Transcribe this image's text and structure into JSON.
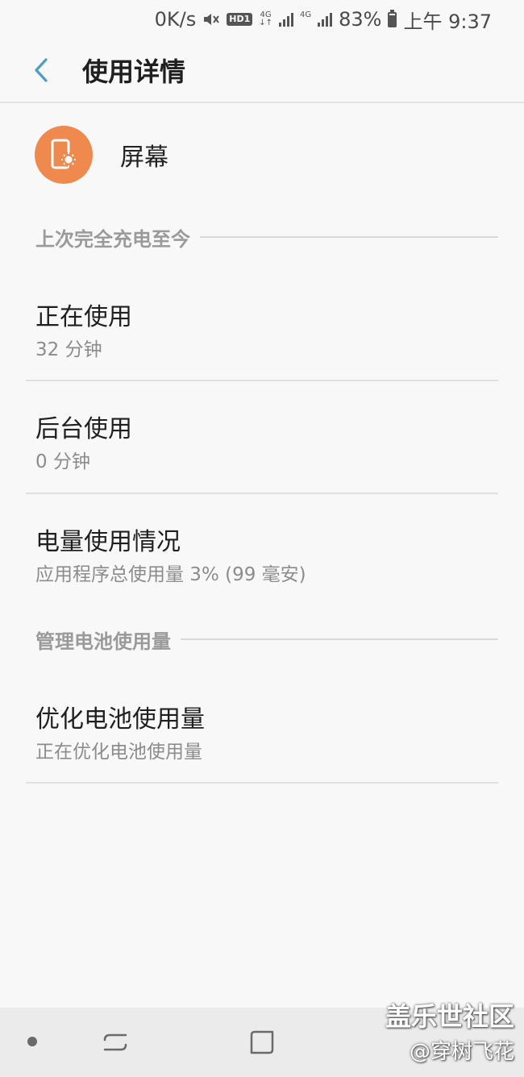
{
  "status_bar": {
    "net_speed": "0K/s",
    "network_1": "4G",
    "network_2": "4G",
    "hd_label": "HD1",
    "battery": "83%",
    "time": "上午 9:37"
  },
  "app_bar": {
    "title": "使用详情",
    "back_icon": "chevron-left-icon",
    "accent_color": "#4a9fc4"
  },
  "app": {
    "name": "屏幕",
    "icon": "screen-brightness-icon",
    "icon_bg": "#f0894d"
  },
  "sections": [
    {
      "label": "上次完全充电至今"
    },
    {
      "label": "管理电池使用量"
    }
  ],
  "items": [
    {
      "title": "正在使用",
      "subtitle": "32 分钟"
    },
    {
      "title": "后台使用",
      "subtitle": "0 分钟"
    },
    {
      "title": "电量使用情况",
      "subtitle": "应用程序总使用量 3% (99 毫安)"
    },
    {
      "title": "优化电池使用量",
      "subtitle": "正在优化电池使用量"
    }
  ],
  "nav_bar": {
    "icons": [
      "dot-icon",
      "recents-icon",
      "home-icon"
    ]
  },
  "watermark": {
    "line1": "盖乐世社区",
    "line2": "@穿树飞花"
  }
}
